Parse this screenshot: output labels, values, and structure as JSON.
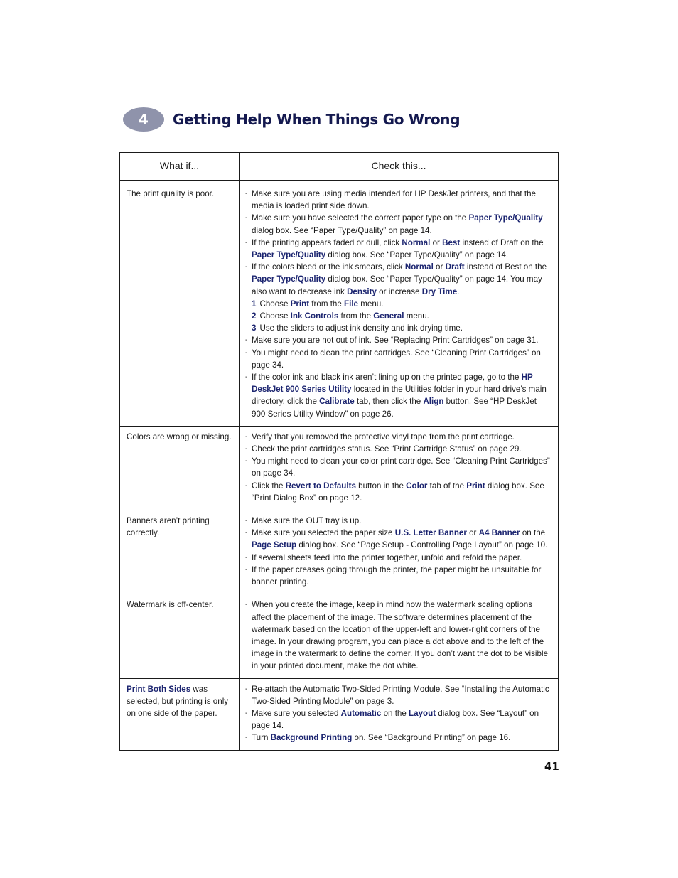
{
  "chapter": {
    "number": "4",
    "title": "Getting Help When Things Go Wrong"
  },
  "table": {
    "headers": [
      "What if...",
      "Check this..."
    ],
    "rows": [
      {
        "problem": [
          {
            "t": "The print quality is poor."
          }
        ],
        "items": [
          {
            "type": "bullet",
            "parts": [
              {
                "t": "Make sure you are using media intended for HP DeskJet printers, and that the media is loaded print side down."
              }
            ]
          },
          {
            "type": "bullet",
            "parts": [
              {
                "t": "Make sure you have selected the correct paper type on the "
              },
              {
                "t": "Paper Type/Quality",
                "kw": true
              },
              {
                "t": " dialog box. See “Paper Type/Quality” on page 14."
              }
            ]
          },
          {
            "type": "bullet",
            "parts": [
              {
                "t": "If the printing appears faded or dull, click "
              },
              {
                "t": "Normal",
                "kw": true
              },
              {
                "t": " or "
              },
              {
                "t": "Best",
                "kw": true
              },
              {
                "t": " instead of Draft on the "
              },
              {
                "t": "Paper Type/Quality",
                "kw": true
              },
              {
                "t": " dialog box. See “Paper Type/Quality” on page 14."
              }
            ]
          },
          {
            "type": "bullet",
            "parts": [
              {
                "t": "If the colors bleed or the ink smears, click "
              },
              {
                "t": "Normal",
                "kw": true
              },
              {
                "t": " or "
              },
              {
                "t": "Draft",
                "kw": true
              },
              {
                "t": " instead of Best on the "
              },
              {
                "t": "Paper Type/Quality",
                "kw": true
              },
              {
                "t": " dialog box. See “Paper Type/Quality” on page 14. You may also want to decrease ink "
              },
              {
                "t": "Density",
                "kw": true
              },
              {
                "t": " or increase "
              },
              {
                "t": "Dry Time",
                "kw": true
              },
              {
                "t": "."
              }
            ]
          },
          {
            "type": "step",
            "num": "1",
            "parts": [
              {
                "t": "Choose "
              },
              {
                "t": "Print",
                "kw": true
              },
              {
                "t": " from the "
              },
              {
                "t": "File",
                "kw": true
              },
              {
                "t": " menu."
              }
            ]
          },
          {
            "type": "step",
            "num": "2",
            "parts": [
              {
                "t": "Choose "
              },
              {
                "t": "Ink Controls",
                "kw": true
              },
              {
                "t": " from the "
              },
              {
                "t": "General",
                "kw": true
              },
              {
                "t": " menu."
              }
            ]
          },
          {
            "type": "step",
            "num": "3",
            "parts": [
              {
                "t": "Use the sliders to adjust ink density and ink drying time."
              }
            ]
          },
          {
            "type": "bullet",
            "parts": [
              {
                "t": "Make sure you are not out of ink. See “Replacing Print Cartridges” on page 31."
              }
            ]
          },
          {
            "type": "bullet",
            "parts": [
              {
                "t": "You might need to clean the print cartridges. See “Cleaning Print Cartridges” on page 34."
              }
            ]
          },
          {
            "type": "bullet",
            "parts": [
              {
                "t": "If the color ink and black ink aren’t lining up on the printed page, go to the "
              },
              {
                "t": "HP DeskJet 900 Series Utility",
                "kw": true
              },
              {
                "t": " located in the Utilities folder in your hard drive’s main directory, click the "
              },
              {
                "t": "Calibrate",
                "kw": true
              },
              {
                "t": " tab, then click the "
              },
              {
                "t": "Align",
                "kw": true
              },
              {
                "t": " button. See “HP DeskJet 900 Series Utility Window” on page 26."
              }
            ]
          }
        ]
      },
      {
        "problem": [
          {
            "t": "Colors are wrong or missing."
          }
        ],
        "items": [
          {
            "type": "bullet",
            "parts": [
              {
                "t": "Verify that you removed the protective vinyl tape from the print cartridge."
              }
            ]
          },
          {
            "type": "bullet",
            "parts": [
              {
                "t": "Check the print cartridges status. See “Print Cartridge Status” on page 29."
              }
            ]
          },
          {
            "type": "bullet",
            "parts": [
              {
                "t": "You might need to clean your color print cartridge. See “Cleaning Print Cartridges” on page 34."
              }
            ]
          },
          {
            "type": "bullet",
            "parts": [
              {
                "t": "Click the "
              },
              {
                "t": "Revert to Defaults",
                "kw": true
              },
              {
                "t": " button in the "
              },
              {
                "t": "Color",
                "kw": true
              },
              {
                "t": " tab of the "
              },
              {
                "t": "Print",
                "kw": true
              },
              {
                "t": " dialog box. See “Print Dialog Box” on page 12."
              }
            ]
          }
        ]
      },
      {
        "problem": [
          {
            "t": "Banners aren’t printing correctly."
          }
        ],
        "items": [
          {
            "type": "bullet",
            "parts": [
              {
                "t": "Make sure the OUT tray is up."
              }
            ]
          },
          {
            "type": "bullet",
            "parts": [
              {
                "t": "Make sure you selected the paper size "
              },
              {
                "t": "U.S. Letter Banner",
                "kw": true
              },
              {
                "t": " or "
              },
              {
                "t": "A4 Banner",
                "kw": true
              },
              {
                "t": " on the "
              },
              {
                "t": "Page Setup",
                "kw": true
              },
              {
                "t": " dialog box. See “Page Setup - Controlling Page Layout” on page 10."
              }
            ]
          },
          {
            "type": "bullet",
            "parts": [
              {
                "t": "If several sheets feed into the printer together, unfold and refold the paper."
              }
            ]
          },
          {
            "type": "bullet",
            "parts": [
              {
                "t": "If the paper creases going through the printer, the paper might be unsuitable for banner printing."
              }
            ]
          }
        ]
      },
      {
        "problem": [
          {
            "t": "Watermark is off-center."
          }
        ],
        "items": [
          {
            "type": "bullet",
            "parts": [
              {
                "t": "When you create the image, keep in mind how the watermark scaling options affect the placement of the image. The software determines placement of the watermark based on the location of the upper-left and lower-right corners of the image. In your drawing program, you can place a dot above and to the left of the image in the watermark to define the corner. If you don’t want the dot to be visible in your printed document, make the dot white."
              }
            ]
          }
        ]
      },
      {
        "problem": [
          {
            "t": "Print Both Sides",
            "kw": true
          },
          {
            "t": " was selected, but printing is only on one side of the paper."
          }
        ],
        "items": [
          {
            "type": "bullet",
            "parts": [
              {
                "t": "Re-attach the Automatic Two-Sided Printing Module. See “Installing the Automatic Two-Sided Printing Module” on page 3."
              }
            ]
          },
          {
            "type": "bullet",
            "parts": [
              {
                "t": "Make sure you selected "
              },
              {
                "t": "Automatic",
                "kw": true
              },
              {
                "t": " on the "
              },
              {
                "t": "Layout",
                "kw": true
              },
              {
                "t": " dialog box. See “Layout” on page 14."
              }
            ]
          },
          {
            "type": "bullet",
            "parts": [
              {
                "t": "Turn "
              },
              {
                "t": "Background Printing",
                "kw": true
              },
              {
                "t": " on. See “Background Printing” on page 16."
              }
            ]
          }
        ]
      }
    ]
  },
  "page_number": "41",
  "colors": {
    "title": "#14194f",
    "keyword": "#1c2570",
    "badge": "#8f93ab"
  }
}
